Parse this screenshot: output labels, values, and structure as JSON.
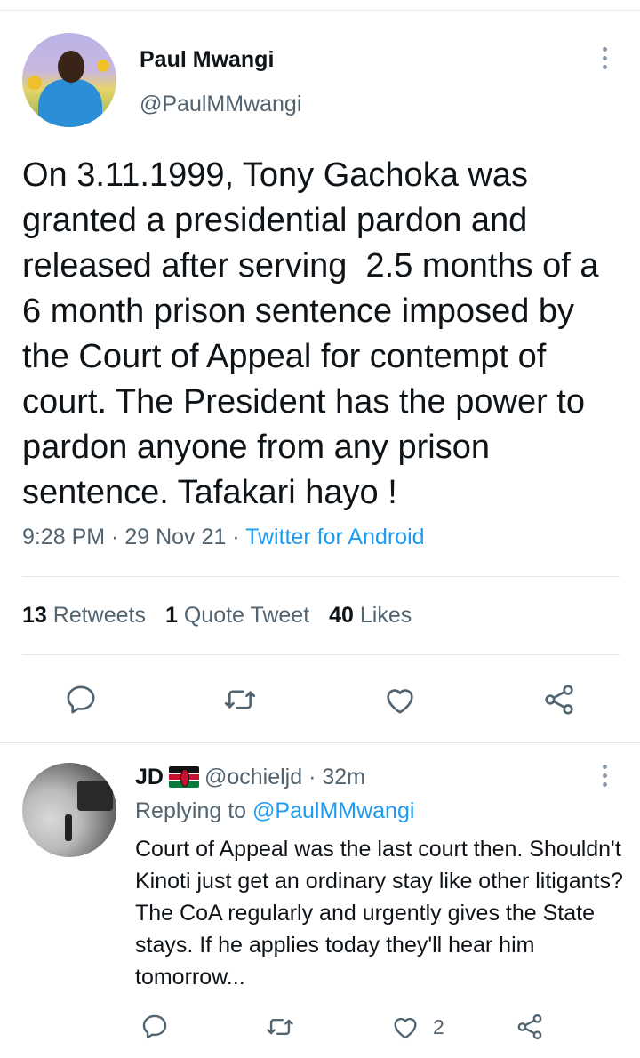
{
  "main_tweet": {
    "author_name": "Paul Mwangi",
    "author_handle": "@PaulMMwangi",
    "text": "On 3.11.1999, Tony Gachoka was granted a presidential pardon and released after serving  2.5 months of a 6 month prison sentence imposed by the Court of Appeal for contempt of court. The President has the power to pardon anyone from any prison sentence. Tafakari hayo !",
    "time": "9:28 PM",
    "date": "29 Nov 21",
    "client": "Twitter for Android",
    "separator": " · ",
    "stats": {
      "retweets_count": "13",
      "retweets_label": "Retweets",
      "quotes_count": "1",
      "quotes_label": "Quote Tweet",
      "likes_count": "40",
      "likes_label": "Likes"
    },
    "actions": [
      "reply-icon",
      "retweet-icon",
      "like-icon",
      "share-icon"
    ]
  },
  "reply": {
    "author_name": "JD",
    "author_handle": "@ochieljd",
    "age": "32m",
    "replying_prefix": "Replying to ",
    "replying_to": "@PaulMMwangi",
    "text": "Court of Appeal was the last court then. Shouldn't Kinoti just get an ordinary stay like other litigants? The CoA regularly and urgently gives the State stays. If he applies today they'll hear him tomorrow...",
    "like_count": "2",
    "actions": [
      "reply-icon",
      "retweet-icon",
      "like-icon",
      "share-icon"
    ]
  },
  "colors": {
    "text": "#0f1419",
    "secondary": "#536471",
    "accent": "#1d9bf0",
    "divider": "#e1e6ea"
  }
}
